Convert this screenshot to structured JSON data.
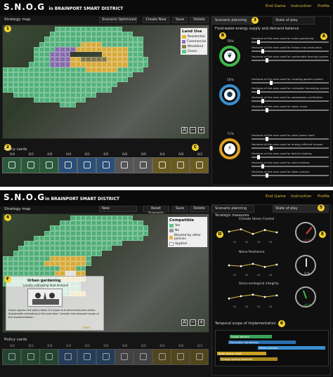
{
  "app": {
    "title": "S.N.O.G",
    "subtitle": "in BRAINPORT SMART DISTRICT",
    "nav": [
      "End Game",
      "Instruction",
      "Profile"
    ]
  },
  "top": {
    "strategy_label": "Strategy map",
    "dropdown_value": "Scenario Optimized",
    "buttons": [
      "Create New",
      "Save",
      "Delete"
    ],
    "badges": {
      "one": "1",
      "two": "2",
      "three": "3",
      "A": "A",
      "B": "B",
      "C": "C"
    },
    "tabs": [
      "Scenario planning",
      "State of play"
    ],
    "legend": {
      "title": "Land Use",
      "items": [
        {
          "label": "Residential",
          "color": "#e8b53a"
        },
        {
          "label": "Commercial",
          "color": "#8e6fb8"
        },
        {
          "label": "Woodland",
          "color": "#8a7a46"
        },
        {
          "label": "Green",
          "color": "#58c98a"
        }
      ]
    },
    "nexus_title": "Food-water-energy supply and demand balance",
    "zoom": [
      "A",
      "−",
      "+"
    ],
    "policy_label": "Policy cards",
    "card_counts": [
      "0/4",
      "0/2",
      "0/6",
      "0/4",
      "0/2",
      "0/5",
      "0/6",
      "0/6",
      "0/4",
      "0/6",
      "0/3"
    ],
    "rings": [
      {
        "pct": "78%",
        "icon": "wheat-icon",
        "color": "#3fb84a",
        "sliders": [
          "Hectares of the area used for urban gardening",
          "Hectares of the area used for Indoor crop production",
          "Hectares of the area used for sustainable farming system"
        ]
      },
      {
        "pct": "56%",
        "icon": "water-drop-icon",
        "color": "#3a8fd0",
        "sliders": [
          "Hectares of the area used for creating garden system",
          "Hectares of the area used for rainwater harvesting system",
          "Hectares of the area used for wastewater purification",
          "Hectares of the area used for water reuse"
        ]
      },
      {
        "pct": "71%",
        "icon": "lightning-icon",
        "color": "#e0a020",
        "sliders": [
          "Hectares of the area used for solar power roofs",
          "Hectares of the area used for energy efficient houses",
          "Hectares of the area used for district heating",
          "Hectares of the area used for wind turbines",
          "Hectares of the area used for other policies"
        ]
      }
    ]
  },
  "bottom": {
    "strategy_label": "Strategy map",
    "dropdown_value": "New",
    "buttons": [
      "Reset Scenario",
      "Save",
      "Delete"
    ],
    "badges": {
      "four": "4",
      "five": "5",
      "six": "6",
      "D": "D",
      "E": "E",
      "F": "F"
    },
    "tabs": [
      "Scenario planning",
      "State of play"
    ],
    "legend": {
      "title": "Compatible",
      "items": [
        {
          "label": "Yes",
          "color": "#58c98a"
        },
        {
          "label": "No",
          "color": "#9a9a9a"
        },
        {
          "label": "Blocked by other policies",
          "color": "#e8b53a"
        },
        {
          "label": "Applied",
          "color": "#ffffff"
        }
      ]
    },
    "measures_title": "Strategic measures",
    "measures": [
      {
        "title": "Climate Stress Control",
        "gauge": "+0 %",
        "color": "#e04040",
        "values": [
          0.55,
          0.7,
          0.4,
          0.65,
          0.5
        ]
      },
      {
        "title": "Noise Resilience",
        "gauge": "0 %",
        "color": "#dddddd",
        "values": [
          0.5,
          0.45,
          0.6,
          0.4,
          0.55
        ]
      },
      {
        "title": "Socio-ecological integrity",
        "gauge": "+0 %",
        "color": "#3fb84a",
        "values": [
          0.4,
          0.55,
          0.65,
          0.5,
          0.6
        ]
      }
    ],
    "chart_x": [
      "01",
      "02",
      "03",
      "04"
    ],
    "timeline_title": "Temporal scope of implementation",
    "timeline": [
      {
        "label": "Urban garden",
        "color": "#3aa35a"
      },
      {
        "label": "Rainwater harvesting",
        "color": "#2a6fb0"
      },
      {
        "label": "Wind turbines",
        "color": "#3a8fd0"
      },
      {
        "label": "Solar power roofs",
        "color": "#c8a020"
      },
      {
        "label": "Energy saving behavior",
        "color": "#a88a20"
      }
    ],
    "callout_title": "Urban gardening",
    "callout_sub": "Locally cultivating food demand",
    "callout_text": "Green spaces: the policy takes 3-5 years to build and become active. Sustainable cultivating is the core idea. Consider the temporal scope of the implementation.",
    "callout_close": "Close",
    "zoom": [
      "A",
      "−",
      "+"
    ],
    "policy_label": "Policy cards",
    "card_counts": [
      "0/4",
      "0/2",
      "0/6",
      "0/4",
      "0/2",
      "0/5",
      "0/6",
      "0/6",
      "0/4",
      "0/6",
      "0/3"
    ]
  }
}
